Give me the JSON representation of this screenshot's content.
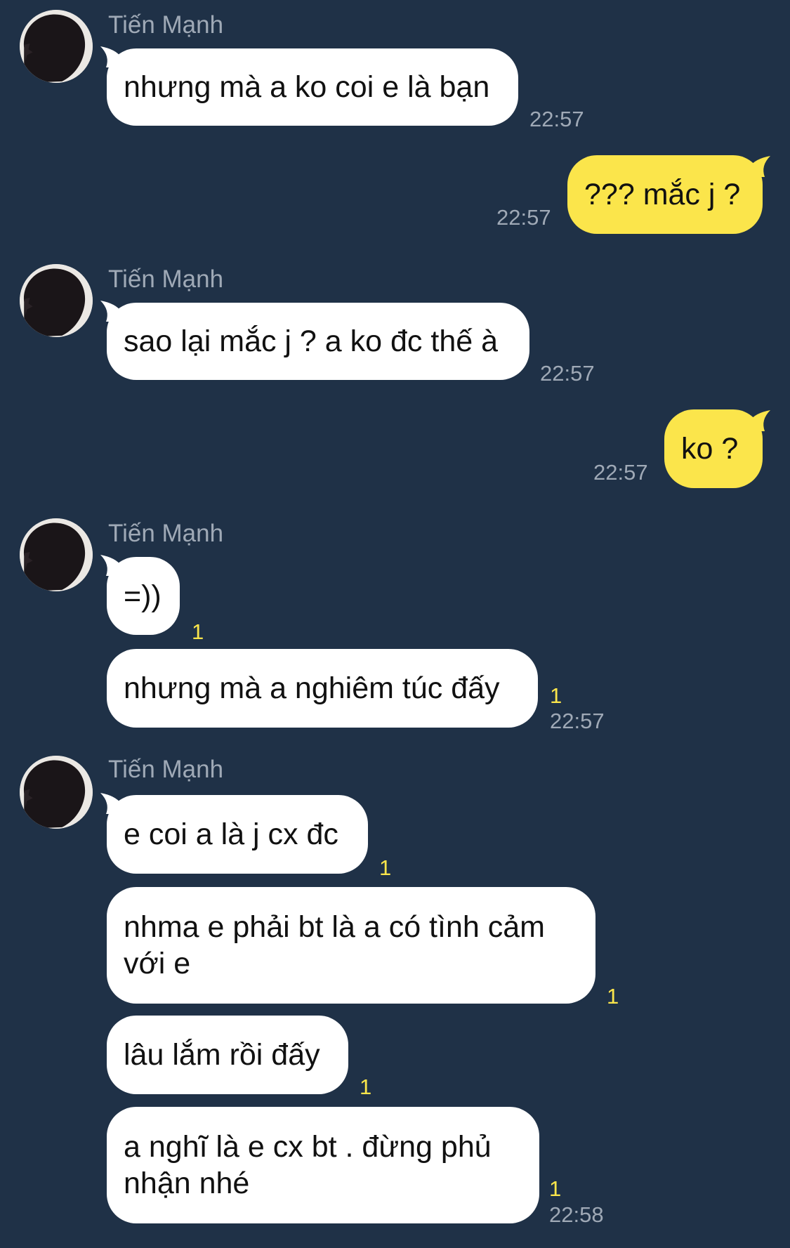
{
  "contact": {
    "name": "Tiến Mạnh"
  },
  "groups": [
    {
      "sender": "Tiến Mạnh",
      "messages": [
        {
          "text": "nhưng mà a ko coi e là bạn",
          "time": "22:57"
        }
      ]
    },
    {
      "sender": "Tiến Mạnh",
      "messages": [
        {
          "text": "sao lại mắc j ? a ko đc thế à",
          "time": "22:57"
        }
      ]
    },
    {
      "sender": "Tiến Mạnh",
      "messages": [
        {
          "text": "=))",
          "read": "1"
        },
        {
          "text": "nhưng mà a nghiêm túc đấy",
          "read": "1",
          "time": "22:57"
        }
      ]
    },
    {
      "sender": "Tiến Mạnh",
      "messages": [
        {
          "text": "e coi a là j cx đc",
          "read": "1"
        },
        {
          "text": "nhma e phải bt là a có tình cảm với e",
          "read": "1"
        },
        {
          "text": "lâu lắm rồi đấy",
          "read": "1"
        },
        {
          "text": "a nghĩ là e cx bt . đừng phủ nhận nhé",
          "read": "1",
          "time": "22:58"
        }
      ]
    }
  ],
  "outgoing": [
    {
      "text": "??? mắc j ?",
      "time": "22:57"
    },
    {
      "text": "ko ?",
      "time": "22:57"
    }
  ],
  "colors": {
    "background": "#1f3147",
    "incoming_bubble": "#ffffff",
    "outgoing_bubble": "#fbe54b",
    "meta_text": "#9fa9b6",
    "read_count": "#fbe54b"
  }
}
